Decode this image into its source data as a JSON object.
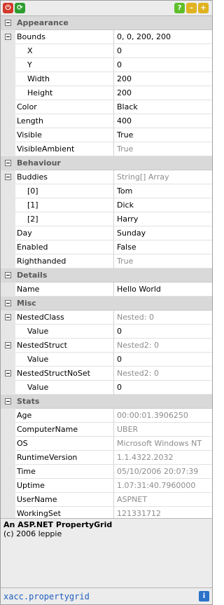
{
  "toolbar": {
    "close_icon_color": "#d23a2a",
    "refresh_icon_color": "#2e9e2e",
    "help_icon_color": "#5fbf2a",
    "minimize_icon_color": "#e0b21f",
    "maximize_icon_color": "#e0b21f"
  },
  "grid": {
    "appearance": {
      "label": "Appearance",
      "bounds_name": "Bounds",
      "bounds_value": "0, 0, 200, 200",
      "x_name": "X",
      "x_value": "0",
      "y_name": "Y",
      "y_value": "0",
      "width_name": "Width",
      "width_value": "200",
      "height_name": "Height",
      "height_value": "200",
      "color_name": "Color",
      "color_value": "Black",
      "length_name": "Length",
      "length_value": "400",
      "visible_name": "Visible",
      "visible_value": "True",
      "visibleambient_name": "VisibleAmbient",
      "visibleambient_value": "True"
    },
    "behaviour": {
      "label": "Behaviour",
      "buddies_name": "Buddies",
      "buddies_value": "String[] Array",
      "b0_name": "[0]",
      "b0_value": "Tom",
      "b1_name": "[1]",
      "b1_value": "Dick",
      "b2_name": "[2]",
      "b2_value": "Harry",
      "day_name": "Day",
      "day_value": "Sunday",
      "enabled_name": "Enabled",
      "enabled_value": "False",
      "righthanded_name": "Righthanded",
      "righthanded_value": "True"
    },
    "details": {
      "label": "Details",
      "name_name": "Name",
      "name_value": "Hello World"
    },
    "misc": {
      "label": "Misc",
      "nestedclass_name": "NestedClass",
      "nestedclass_value": "Nested: 0",
      "nc_value_name": "Value",
      "nc_value_value": "0",
      "nestedstruct_name": "NestedStruct",
      "nestedstruct_value": "Nested2: 0",
      "ns_value_name": "Value",
      "ns_value_value": "0",
      "nestedstructnoset_name": "NestedStructNoSet",
      "nestedstructnoset_value": "Nested2: 0",
      "nsns_value_name": "Value",
      "nsns_value_value": "0"
    },
    "stats": {
      "label": "Stats",
      "age_name": "Age",
      "age_value": "00:00:01.3906250",
      "computername_name": "ComputerName",
      "computername_value": "UBER",
      "os_name": "OS",
      "os_value": "Microsoft Windows NT",
      "runtime_name": "RuntimeVersion",
      "runtime_value": "1.1.4322.2032",
      "time_name": "Time",
      "time_value": "05/10/2006 20:07:39",
      "uptime_name": "Uptime",
      "uptime_value": "1.07:31:40.7960000",
      "username_name": "UserName",
      "username_value": "ASPNET",
      "workingset_name": "WorkingSet",
      "workingset_value": "121331712"
    }
  },
  "info": {
    "title": "An ASP.NET PropertyGrid",
    "subtitle": "(c) 2006 leppie"
  },
  "footer": {
    "label": "xacc.propertygrid"
  }
}
